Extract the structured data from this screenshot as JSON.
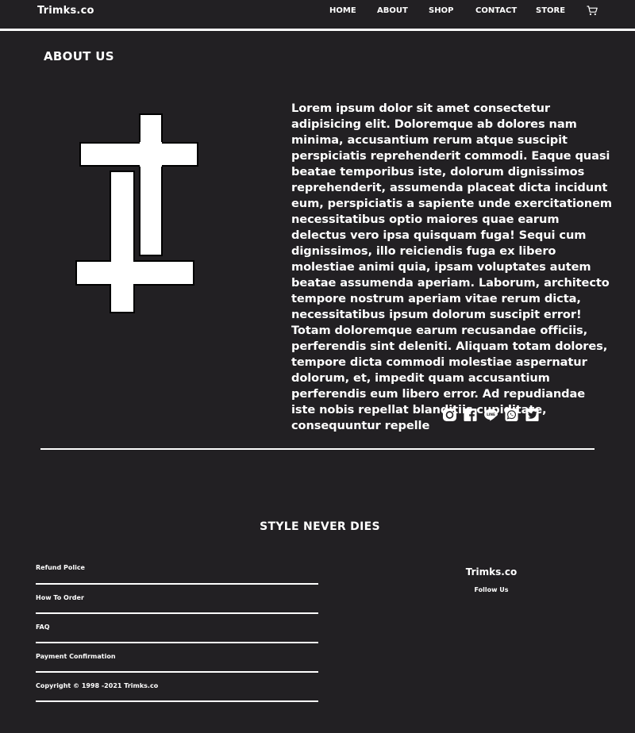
{
  "navbar": {
    "brand": "Trimks.co",
    "links": [
      "HOME",
      "ABOUT",
      "SHOP",
      "CONTACT",
      "STORE"
    ],
    "cart_icon": "cart-icon"
  },
  "about": {
    "title": "ABOUT US",
    "body": "Lorem ipsum dolor sit amet consectetur adipisicing elit. Doloremque ab dolores nam minima, accusantium rerum atque suscipit perspiciatis reprehenderit commodi. Eaque quasi beatae temporibus iste, dolorum dignissimos reprehenderit, assumenda placeat dicta incidunt eum, perspiciatis a sapiente unde exercitationem necessitatibus optio maiores quae earum delectus vero ipsa quisquam fuga! Sequi cum dignissimos, illo reiciendis fuga ex libero molestiae animi quia, ipsam voluptates autem beatae assumenda aperiam. Laborum, architecto tempore nostrum aperiam vitae rerum dicta, necessitatibus ipsum dolorum suscipit error! Totam doloremque earum recusandae officiis, perferendis sint deleniti. Aliquam totam dolores, tempore dicta commodi molestiae aspernatur dolorum, et, impedit quam accusantium perferendis eum libero error. Ad repudiandae iste nobis repellat blanditiis cupiditate, consequuntur repelle",
    "image": "inverted-crosses-logo",
    "social_icons": [
      "instagram-icon",
      "facebook-icon",
      "line-icon",
      "whatsapp-icon",
      "twitter-icon"
    ],
    "line_icon_text": "LINE"
  },
  "footer": {
    "tagline": "STYLE NEVER DIES",
    "links": [
      "Refund Police",
      "How To Order",
      "FAQ",
      "Payment Confirmation"
    ],
    "copyright": "Copyright © 1998 -2021 Trimks.co",
    "brand": "Trimks.co",
    "follow": "Follow Us"
  },
  "colors": {
    "background": "#222023",
    "foreground": "#ffffff"
  }
}
